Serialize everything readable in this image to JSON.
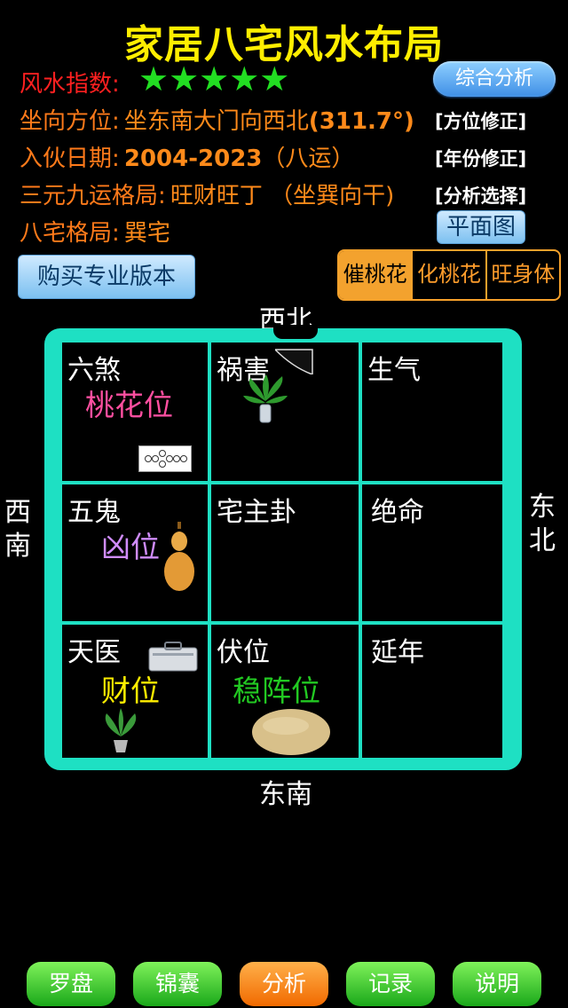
{
  "title": "家居八宅风水布局",
  "fengshui": {
    "label": "风水指数:",
    "stars": "★★★★★",
    "analysis_button": "综合分析"
  },
  "rows": [
    {
      "label": "坐向方位:",
      "value": "坐东南大门向西北",
      "extra": "(311.7°)",
      "bracket": "[方位修正]"
    },
    {
      "label": "入伙日期:",
      "value": "2004-2023",
      "extra": "（八运）",
      "bracket": "[年份修正]"
    },
    {
      "label": "三元九运格局:",
      "value": "旺财旺丁 （坐巽向干)",
      "extra": "",
      "bracket": "[分析选择]"
    },
    {
      "label": "八宅格局:",
      "value": "巽宅",
      "extra": "",
      "bracket": ""
    }
  ],
  "plan_button": "平面图",
  "buy_button": "购买专业版本",
  "tabs": [
    "催桃花",
    "化桃花",
    "旺身体"
  ],
  "directions": {
    "top": "西北",
    "bottom": "东南",
    "left1": "西",
    "left2": "南",
    "right1": "东",
    "right2": "北"
  },
  "cells": [
    {
      "name": "六煞",
      "position": "桃花位",
      "position_color": "#ff4fa0"
    },
    {
      "name": "祸害",
      "position": "",
      "position_color": "#ffffff"
    },
    {
      "name": "生气",
      "position": "",
      "position_color": "#ffffff"
    },
    {
      "name": "五鬼",
      "position": "凶位",
      "position_color": "#d08cff"
    },
    {
      "name": "宅主卦",
      "position": "",
      "position_color": "#ffffff"
    },
    {
      "name": "绝命",
      "position": "",
      "position_color": "#ffffff"
    },
    {
      "name": "天医",
      "position": "财位",
      "position_color": "#ffee00"
    },
    {
      "name": "伏位",
      "position": "稳阵位",
      "position_color": "#22c922"
    },
    {
      "name": "延年",
      "position": "",
      "position_color": "#ffffff"
    }
  ],
  "bottom_nav": [
    "罗盘",
    "锦囊",
    "分析",
    "记录",
    "说明"
  ]
}
